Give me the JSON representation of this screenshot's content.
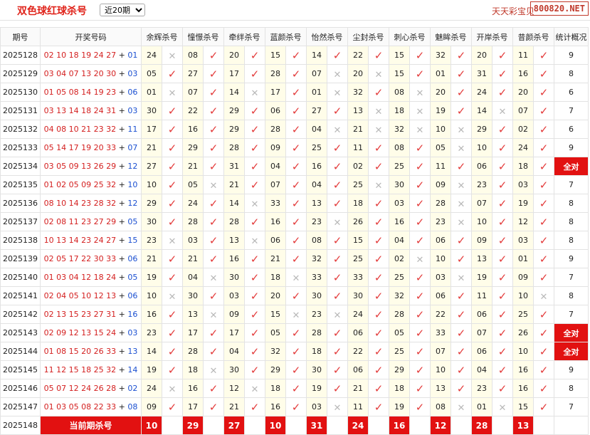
{
  "header": {
    "title": "双色球红球杀号",
    "period_select": "近20期",
    "site_name": "天天彩宝贝",
    "site_url": "800820.NET"
  },
  "columns": {
    "issue": "期号",
    "draw": "开奖号码",
    "experts": [
      "余辉杀号",
      "憧憬杀号",
      "牵绊杀号",
      "蓝颜杀号",
      "怡然杀号",
      "尘封杀号",
      "刺心杀号",
      "魅眸杀号",
      "开岸杀号",
      "昔颜杀号"
    ],
    "stat": "统计概况"
  },
  "rows": [
    {
      "issue": "2025128",
      "red": "02 10 18 19 24 27",
      "blue": "01",
      "kills": [
        "24",
        "08",
        "20",
        "15",
        "14",
        "22",
        "15",
        "32",
        "20",
        "11"
      ],
      "hits": [
        0,
        1,
        1,
        1,
        1,
        1,
        1,
        1,
        1,
        1
      ],
      "stat": "9"
    },
    {
      "issue": "2025129",
      "red": "03 04 07 13 20 30",
      "blue": "03",
      "kills": [
        "05",
        "27",
        "17",
        "28",
        "07",
        "20",
        "15",
        "01",
        "31",
        "16"
      ],
      "hits": [
        1,
        1,
        1,
        1,
        0,
        0,
        1,
        1,
        1,
        1
      ],
      "stat": "8"
    },
    {
      "issue": "2025130",
      "red": "01 05 08 14 19 23",
      "blue": "06",
      "kills": [
        "01",
        "07",
        "14",
        "17",
        "01",
        "32",
        "08",
        "20",
        "24",
        "20"
      ],
      "hits": [
        0,
        1,
        0,
        1,
        0,
        1,
        0,
        1,
        1,
        1
      ],
      "stat": "6"
    },
    {
      "issue": "2025131",
      "red": "03 13 14 18 24 31",
      "blue": "03",
      "kills": [
        "30",
        "22",
        "29",
        "06",
        "27",
        "13",
        "18",
        "19",
        "14",
        "07"
      ],
      "hits": [
        1,
        1,
        1,
        1,
        1,
        0,
        0,
        1,
        0,
        1
      ],
      "stat": "7"
    },
    {
      "issue": "2025132",
      "red": "04 08 10 21 23 32",
      "blue": "11",
      "kills": [
        "17",
        "16",
        "29",
        "28",
        "04",
        "21",
        "32",
        "10",
        "29",
        "02"
      ],
      "hits": [
        1,
        1,
        1,
        1,
        0,
        0,
        0,
        0,
        1,
        1
      ],
      "stat": "6"
    },
    {
      "issue": "2025133",
      "red": "05 14 17 19 20 33",
      "blue": "07",
      "kills": [
        "21",
        "29",
        "28",
        "09",
        "25",
        "11",
        "08",
        "05",
        "10",
        "24"
      ],
      "hits": [
        1,
        1,
        1,
        1,
        1,
        1,
        1,
        0,
        1,
        1
      ],
      "stat": "9"
    },
    {
      "issue": "2025134",
      "red": "03 05 09 13 26 29",
      "blue": "12",
      "kills": [
        "27",
        "21",
        "31",
        "04",
        "16",
        "02",
        "25",
        "11",
        "06",
        "18"
      ],
      "hits": [
        1,
        1,
        1,
        1,
        1,
        1,
        1,
        1,
        1,
        1
      ],
      "stat": "全对"
    },
    {
      "issue": "2025135",
      "red": "01 02 05 09 25 32",
      "blue": "10",
      "kills": [
        "10",
        "05",
        "21",
        "07",
        "04",
        "25",
        "30",
        "09",
        "23",
        "03"
      ],
      "hits": [
        1,
        0,
        1,
        1,
        1,
        0,
        1,
        0,
        1,
        1
      ],
      "stat": "7"
    },
    {
      "issue": "2025136",
      "red": "08 10 14 23 28 32",
      "blue": "12",
      "kills": [
        "29",
        "24",
        "14",
        "33",
        "13",
        "18",
        "03",
        "28",
        "07",
        "19"
      ],
      "hits": [
        1,
        1,
        0,
        1,
        1,
        1,
        1,
        0,
        1,
        1
      ],
      "stat": "8"
    },
    {
      "issue": "2025137",
      "red": "02 08 11 23 27 29",
      "blue": "05",
      "kills": [
        "30",
        "28",
        "28",
        "16",
        "23",
        "26",
        "16",
        "23",
        "10",
        "12"
      ],
      "hits": [
        1,
        1,
        1,
        1,
        0,
        1,
        1,
        0,
        1,
        1
      ],
      "stat": "8"
    },
    {
      "issue": "2025138",
      "red": "10 13 14 23 24 27",
      "blue": "15",
      "kills": [
        "23",
        "03",
        "13",
        "06",
        "08",
        "15",
        "04",
        "06",
        "09",
        "03"
      ],
      "hits": [
        0,
        1,
        0,
        1,
        1,
        1,
        1,
        1,
        1,
        1
      ],
      "stat": "8"
    },
    {
      "issue": "2025139",
      "red": "02 05 17 22 30 33",
      "blue": "06",
      "kills": [
        "21",
        "21",
        "16",
        "21",
        "32",
        "25",
        "02",
        "10",
        "13",
        "01"
      ],
      "hits": [
        1,
        1,
        1,
        1,
        1,
        1,
        0,
        1,
        1,
        1
      ],
      "stat": "9"
    },
    {
      "issue": "2025140",
      "red": "01 03 04 12 18 24",
      "blue": "05",
      "kills": [
        "19",
        "04",
        "30",
        "18",
        "33",
        "33",
        "25",
        "03",
        "19",
        "09"
      ],
      "hits": [
        1,
        0,
        1,
        0,
        1,
        1,
        1,
        0,
        1,
        1
      ],
      "stat": "7"
    },
    {
      "issue": "2025141",
      "red": "02 04 05 10 12 13",
      "blue": "06",
      "kills": [
        "10",
        "30",
        "03",
        "20",
        "30",
        "30",
        "32",
        "06",
        "11",
        "10"
      ],
      "hits": [
        0,
        1,
        1,
        1,
        1,
        1,
        1,
        1,
        1,
        0
      ],
      "stat": "8"
    },
    {
      "issue": "2025142",
      "red": "02 13 15 23 27 31",
      "blue": "16",
      "kills": [
        "16",
        "13",
        "09",
        "15",
        "23",
        "24",
        "28",
        "22",
        "06",
        "25"
      ],
      "hits": [
        1,
        0,
        1,
        0,
        0,
        1,
        1,
        1,
        1,
        1
      ],
      "stat": "7"
    },
    {
      "issue": "2025143",
      "red": "02 09 12 13 15 24",
      "blue": "03",
      "kills": [
        "23",
        "17",
        "17",
        "05",
        "28",
        "06",
        "05",
        "33",
        "07",
        "26"
      ],
      "hits": [
        1,
        1,
        1,
        1,
        1,
        1,
        1,
        1,
        1,
        1
      ],
      "stat": "全对"
    },
    {
      "issue": "2025144",
      "red": "01 08 15 20 26 33",
      "blue": "13",
      "kills": [
        "14",
        "28",
        "04",
        "32",
        "18",
        "22",
        "25",
        "07",
        "06",
        "10"
      ],
      "hits": [
        1,
        1,
        1,
        1,
        1,
        1,
        1,
        1,
        1,
        1
      ],
      "stat": "全对"
    },
    {
      "issue": "2025145",
      "red": "11 12 15 18 25 32",
      "blue": "14",
      "kills": [
        "19",
        "18",
        "30",
        "29",
        "30",
        "06",
        "29",
        "10",
        "04",
        "16"
      ],
      "hits": [
        1,
        0,
        1,
        1,
        1,
        1,
        1,
        1,
        1,
        1
      ],
      "stat": "9"
    },
    {
      "issue": "2025146",
      "red": "05 07 12 24 26 28",
      "blue": "02",
      "kills": [
        "24",
        "16",
        "12",
        "18",
        "19",
        "21",
        "18",
        "13",
        "23",
        "16"
      ],
      "hits": [
        0,
        1,
        0,
        1,
        1,
        1,
        1,
        1,
        1,
        1
      ],
      "stat": "8"
    },
    {
      "issue": "2025147",
      "red": "01 03 05 08 22 33",
      "blue": "08",
      "kills": [
        "09",
        "17",
        "21",
        "16",
        "03",
        "11",
        "19",
        "08",
        "01",
        "15"
      ],
      "hits": [
        1,
        1,
        1,
        1,
        0,
        1,
        1,
        0,
        0,
        1
      ],
      "stat": "7"
    }
  ],
  "current": {
    "issue": "2025148",
    "label": "当前期杀号",
    "kills": [
      "10",
      "29",
      "27",
      "10",
      "31",
      "24",
      "16",
      "12",
      "28",
      "13"
    ]
  },
  "icons": {
    "hit": "check-mark-icon",
    "miss": "cross-mark-icon"
  },
  "colors": {
    "title_red": "#e0241b",
    "highlight_red": "#e21111",
    "blue_ball": "#1a4fd1",
    "kill_bg": "#fffde9"
  }
}
